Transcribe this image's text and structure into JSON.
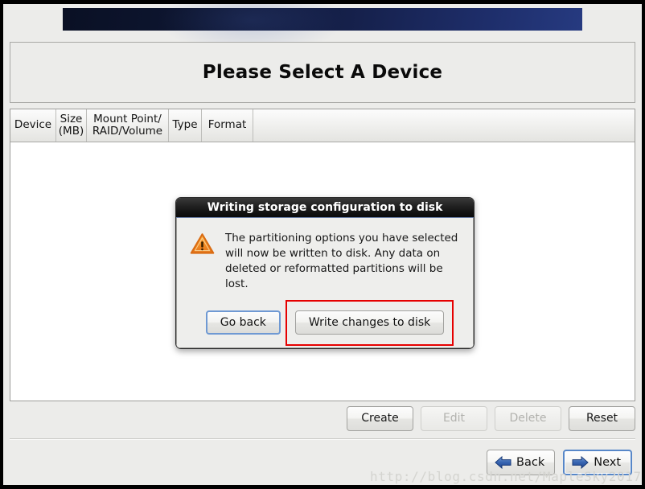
{
  "window": {
    "title": "Please Select A Device"
  },
  "banner": {
    "name": "installer-banner"
  },
  "table": {
    "columns": [
      "Device",
      "Size\n(MB)",
      "Mount Point/\nRAID/Volume",
      "Type",
      "Format"
    ],
    "rows": []
  },
  "actions": {
    "buttons": [
      {
        "label": "Create",
        "enabled": true
      },
      {
        "label": "Edit",
        "enabled": false
      },
      {
        "label": "Delete",
        "enabled": false
      },
      {
        "label": "Reset",
        "enabled": true
      }
    ]
  },
  "navigation": {
    "back_label": "Back",
    "next_label": "Next",
    "next_focused": true
  },
  "dialog": {
    "title": "Writing storage configuration to disk",
    "icon": "warning-triangle-icon",
    "message": "The partitioning options you have selected\nwill now be written to disk.  Any data on\ndeleted or reformatted partitions will be lost.",
    "buttons": [
      {
        "label": "Go back",
        "focused": true,
        "highlighted": false
      },
      {
        "label": "Write changes to disk",
        "focused": false,
        "highlighted": true
      }
    ]
  },
  "watermark": {
    "text": "http://blog.csdn.net/MapleSky2017"
  },
  "colors": {
    "banner_start": "#0a1024",
    "banner_end": "#263a80",
    "window_bg": "#ececea",
    "table_bg": "#ffffff",
    "highlight": "#e60000",
    "focus": "#5787c8",
    "warning": "#f0862a",
    "nav_arrow": "#2e5ba8"
  }
}
